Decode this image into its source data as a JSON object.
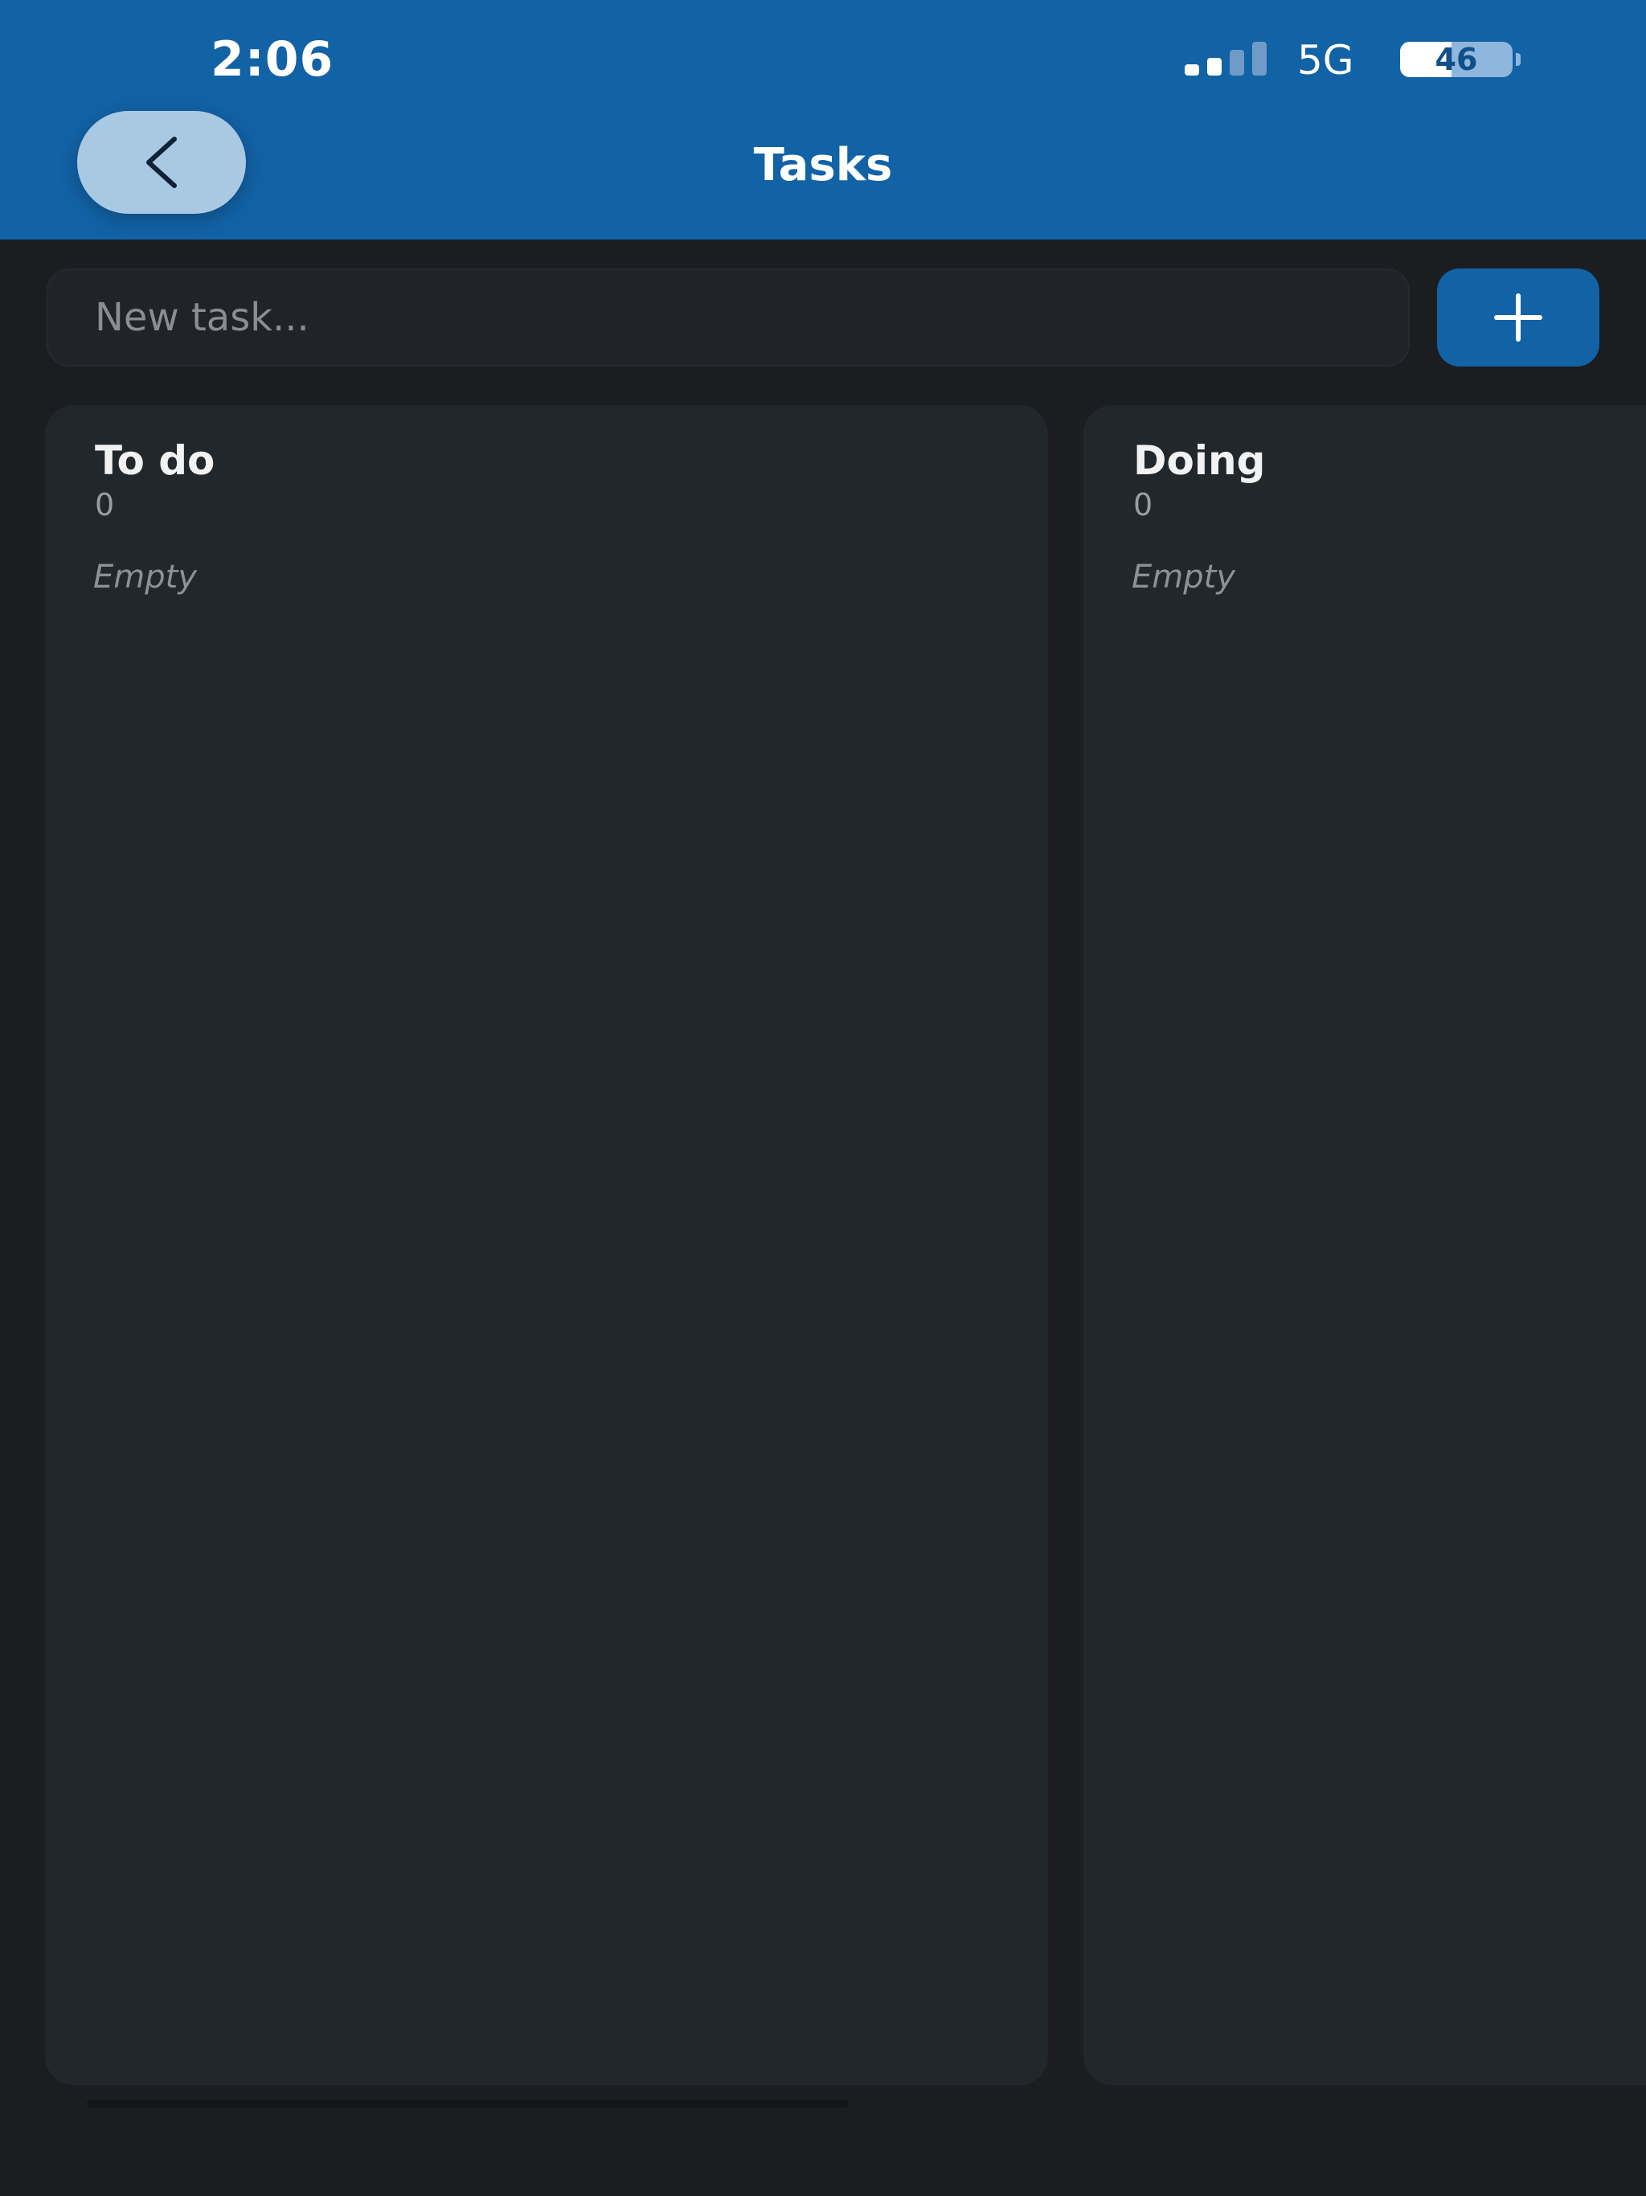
{
  "status_bar": {
    "time": "2:06",
    "network": "5G",
    "battery_percent": "46",
    "battery_level": 0.46,
    "signal_bars_active": 2,
    "signal_bars_total": 4
  },
  "header": {
    "title": "Tasks",
    "back_icon": "chevron-left-icon",
    "background": "#1262a6"
  },
  "new_task": {
    "placeholder": "New task...",
    "value": "",
    "add_icon": "plus-icon",
    "add_button_color": "#1262a6"
  },
  "board": {
    "columns": [
      {
        "title": "To do",
        "count": "0",
        "empty_text": "Empty"
      },
      {
        "title": "Doing",
        "count": "0",
        "empty_text": "Empty"
      }
    ]
  },
  "colors": {
    "background": "#1b1d21",
    "column": "#22272b",
    "accent": "#1262a6"
  }
}
